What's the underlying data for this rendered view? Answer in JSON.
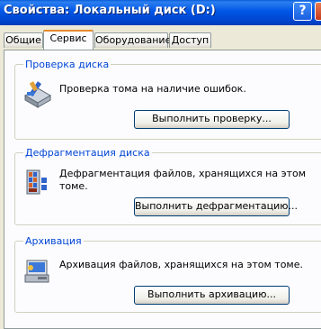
{
  "window": {
    "title": "Свойства: Локальный диск (D:)",
    "help_label": "?",
    "close_label": "✕"
  },
  "tabs": [
    {
      "label": "Общие"
    },
    {
      "label": "Сервис"
    },
    {
      "label": "Оборудование"
    },
    {
      "label": "Доступ"
    }
  ],
  "groups": {
    "check": {
      "title": "Проверка диска",
      "description": "Проверка тома на наличие ошибок.",
      "button": "Выполнить проверку...",
      "icon": "check-disk-icon"
    },
    "defrag": {
      "title": "Дефрагментация диска",
      "description_line1": "Дефрагментация файлов, хранящихся на этом",
      "description_line2": "томе.",
      "button": "Выполнить дефрагментацию...",
      "icon": "defrag-icon"
    },
    "backup": {
      "title": "Архивация",
      "description": "Архивация файлов, хранящихся на этом томе.",
      "button": "Выполнить архивацию...",
      "icon": "backup-icon"
    }
  },
  "colors": {
    "titlebar": "#0054e3",
    "group_title": "#0046d5",
    "active_tab_accent": "#e68b2c"
  }
}
